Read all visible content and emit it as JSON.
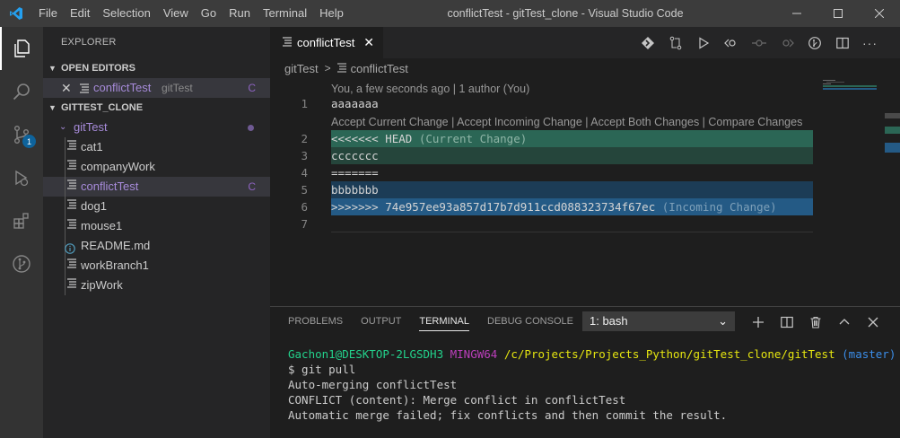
{
  "window": {
    "title": "conflictTest - gitTest_clone - Visual Studio Code",
    "menu": [
      "File",
      "Edit",
      "Selection",
      "View",
      "Go",
      "Run",
      "Terminal",
      "Help"
    ]
  },
  "activity": {
    "scm_badge": "1"
  },
  "sidebar": {
    "title": "EXPLORER",
    "open_editors": {
      "label": "OPEN EDITORS",
      "item": {
        "name": "conflictTest",
        "folder": "gitTest",
        "status": "C"
      }
    },
    "workspace": {
      "label": "GITTEST_CLONE",
      "folder": "gitTest",
      "files": [
        {
          "name": "cat1",
          "status": ""
        },
        {
          "name": "companyWork",
          "status": ""
        },
        {
          "name": "conflictTest",
          "status": "C"
        },
        {
          "name": "dog1",
          "status": ""
        },
        {
          "name": "mouse1",
          "status": ""
        },
        {
          "name": "README.md",
          "status": ""
        },
        {
          "name": "workBranch1",
          "status": ""
        },
        {
          "name": "zipWork",
          "status": ""
        }
      ]
    }
  },
  "editor": {
    "tab_label": "conflictTest",
    "breadcrumb": [
      "gitTest",
      "conflictTest"
    ],
    "blame": "You, a few seconds ago | 1 author (You)",
    "codelens": "Accept Current Change | Accept Incoming Change | Accept Both Changes | Compare Changes",
    "lines": [
      {
        "n": "1",
        "text": "aaaaaaa"
      },
      {
        "n": "2",
        "text": "<<<<<<< HEAD",
        "note": "(Current Change)"
      },
      {
        "n": "3",
        "text": "ccccccc"
      },
      {
        "n": "4",
        "text": "======="
      },
      {
        "n": "5",
        "text": "bbbbbbb"
      },
      {
        "n": "6",
        "text": ">>>>>>> 74e957ee93a857d17b7d911ccd088323734f67ec",
        "note": "(Incoming Change)"
      },
      {
        "n": "7",
        "text": ""
      }
    ]
  },
  "panel": {
    "tabs": [
      "PROBLEMS",
      "OUTPUT",
      "TERMINAL",
      "DEBUG CONSOLE"
    ],
    "terminal_select": "1: bash",
    "terminal": {
      "user": "Gachon1@DESKTOP-2LGSDH3",
      "env": "MINGW64",
      "path": "/c/Projects/Projects_Python/gitTest_clone/gitTest",
      "branch": "(master)",
      "command": "$ git pull",
      "output": [
        "Auto-merging conflictTest",
        "CONFLICT (content): Merge conflict in conflictTest",
        "Automatic merge failed; fix conflicts and then commit the result."
      ]
    }
  }
}
